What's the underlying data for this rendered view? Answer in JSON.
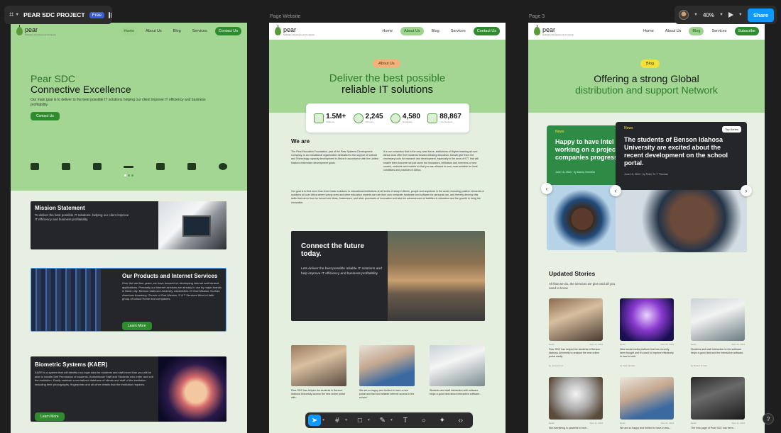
{
  "figma": {
    "project_name": "PEAR SDC PROJECT",
    "plan_badge": "Free",
    "zoom": "40%",
    "share_label": "Share",
    "frame_labels": [
      "Page Website",
      "Page 3"
    ]
  },
  "brand": {
    "logo_text": "pear",
    "logo_sub": "Software Development Company"
  },
  "frame1": {
    "nav": [
      "Home",
      "About Us",
      "Blog",
      "Services",
      "Contact Us"
    ],
    "hero_title_1": "Pear SDC",
    "hero_title_2": "Connective Excellence",
    "hero_desc": "Our main goal is to deliver to the best possible IT solutions helping our client improve IT efficiency and business profitability.",
    "hero_btn": "Contact Us",
    "mission_title": "Mission Statement",
    "mission_desc": "To deliver the best possible IT solutions, helping our client improve IT efficiency and business profitability.",
    "products_title": "Our Products and Internet Services",
    "products_desc": "Over the last four years, we have focused on developing internet and intranet applications. Presently our internet services are already in use by major brands in Benin city: Benson Idahosa University, Assemblies Of God Mission, Norhan American Academy, Church of God Mission, S & T Services Word of faith group of school Home and companies.",
    "products_btn": "Learn More",
    "bio_title": "Biometric Systems (KAER)",
    "bio_desc": "KAER is a system that will identify non-login data for students and staff more than you will be able to handle.Self Permission of students, Authenticate Staff and Students who enter and exit the institution. Easily maintain a centralized database of clients and staff of the institution including their photographs, fingerprints and all other details that the institution requires.",
    "bio_btn": "Learn More"
  },
  "frame2": {
    "nav": [
      "Home",
      "About Us",
      "Blog",
      "Services",
      "Contact Us"
    ],
    "pill": "About Us",
    "hero_title_1": "Deliver the best possible",
    "hero_title_2": "reliable IT solutions",
    "stats": [
      {
        "num": "1.5M+",
        "label": "Students"
      },
      {
        "num": "2,245",
        "label": "Partners"
      },
      {
        "num": "4,580",
        "label": "Graduates"
      },
      {
        "num": "88,867",
        "label": "Live Students"
      }
    ],
    "we_are": "We are",
    "para_left": "The Pear Education Foundation, part of the Pear Systems Development Company, is an educational organization dedicated to the support of science and Technology capacity development in Africa in accordance with the United Nations millennium development goals.",
    "para_right": "It is our conviction that in the very near future, institutions of Higher learning all over Africa must offer their students forward-thinking education, but will give them the necessary tools for research and development, especially in the area of ICT, that will enable them become not just users but innovators, inflitrators and inventors of new modes, methods and models so that you are allowed to own, most suitable for local conditions and practices in Africa.",
    "para_full": "Our goal is to find more than three basic solutions to educational institutions at all levels of study in Benin, people and anywhere in the world, including positive elements of solutions all over Africa where young ones and other education experts can use their own computer hardware and software for personal use, and thereby develop this skills that can in time be turned into ideas, businesses, and other processes of innovation and also the advancement of facilities in education and the growth to bring the innovation.",
    "cta_title": "Connect the future today.",
    "cta_desc": "Lets deliver the best possible reliable IT solutions and help improve IT efficiency and business profitability",
    "thumbs": [
      "Pear SDC has helped the students in Benson Idahosa University access the new online portal with...",
      "We are so happy and thrilled to have a new portal and fast and reliable internet access in the school...",
      "Students and staff interaction with software helps a good deal about interactive software..."
    ]
  },
  "frame3": {
    "nav": [
      "Home",
      "About Us",
      "Blog",
      "Services",
      "Subscribe"
    ],
    "pill": "Blog",
    "hero_title_1": "Offering a strong Global",
    "hero_title_2": "distribution and support Network",
    "back_tag": "News",
    "back_title": "Happy to have Intel working on a project companies progress",
    "back_meta": "June 15, 2024 · by Danny Gembler",
    "front_tag": "News",
    "front_badge": "Top Series",
    "front_title": "The students of Benson Idahosa University are excited about the recent development on the school portal.",
    "front_meta": "June 15, 2024 · by Peter Sr. T Thomas",
    "updated_title": "Updated Stories",
    "updated_sub": "All that we do, the services we give and all you need to know",
    "stories": [
      {
        "tag": "News",
        "date": "June 11, 2024",
        "cap": "Pear SDC has helped the students in Benson Idahosa University to analyse the new online portal easily.",
        "author": "by Jessica Doe"
      },
      {
        "tag": "News",
        "date": "June 11, 2024",
        "cap": "New social media platform that has recently been bought and it's used to improve effectively in how to look.",
        "author": "by Kate Mendez"
      },
      {
        "tag": "News",
        "date": "June 11, 2024",
        "cap": "Students and staff interaction to the software helps a good deal and the interactive software.",
        "author": "by Robert W Hoe"
      },
      {
        "tag": "News",
        "date": "June 11, 2024",
        "cap": "Not everything is powerful to tech...",
        "author": ""
      },
      {
        "tag": "News",
        "date": "June 11, 2024",
        "cap": "We are so happy and thrilled to have a new...",
        "author": ""
      },
      {
        "tag": "News",
        "date": "June 11, 2024",
        "cap": "The new page of Pear SDC has been...",
        "author": ""
      }
    ]
  },
  "toolbar": {
    "tools": [
      "move-tool",
      "frame-tool",
      "shape-tool",
      "pen-tool",
      "text-tool",
      "comment-tool",
      "actions-tool",
      "dev-mode-tool"
    ]
  },
  "help_label": "?"
}
